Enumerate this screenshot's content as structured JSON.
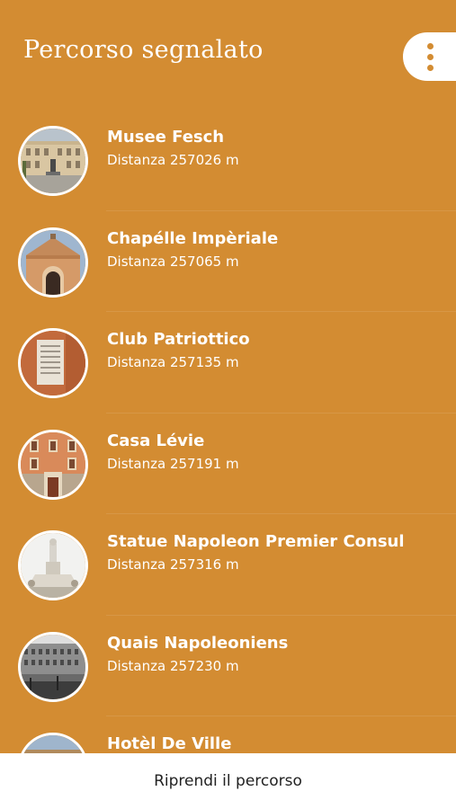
{
  "header": {
    "title": "Percorso segnalato",
    "menu_icon": "more-vertical-icon"
  },
  "colors": {
    "background": "#d38c32",
    "text": "#ffffff",
    "bottom_bar": "#ffffff"
  },
  "items": [
    {
      "name": "Musee Fesch",
      "distance": "Distanza 257026 m"
    },
    {
      "name": "Chapélle Impèriale",
      "distance": "Distanza 257065 m"
    },
    {
      "name": "Club Patriottico",
      "distance": "Distanza 257135 m"
    },
    {
      "name": "Casa Lévie",
      "distance": "Distanza 257191 m"
    },
    {
      "name": "Statue Napoleon Premier Consul",
      "distance": "Distanza 257316 m"
    },
    {
      "name": "Quais Napoleoniens",
      "distance": "Distanza 257230 m"
    },
    {
      "name": "Hotèl De Ville",
      "distance": ""
    }
  ],
  "bottom_bar": {
    "label": "Riprendi il percorso"
  }
}
